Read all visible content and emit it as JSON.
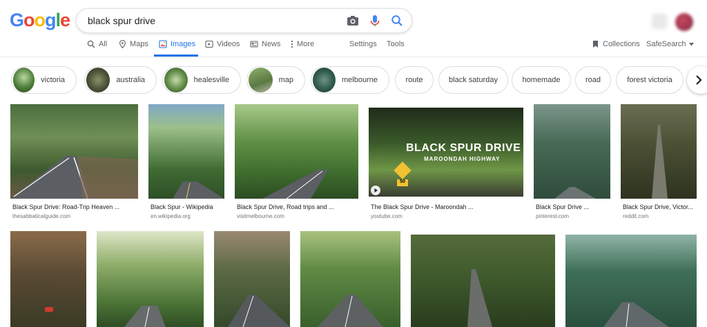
{
  "search": {
    "query": "black spur drive"
  },
  "tabs": [
    {
      "label": "All",
      "icon": "search-icon"
    },
    {
      "label": "Maps",
      "icon": "map-pin-icon"
    },
    {
      "label": "Images",
      "icon": "image-icon"
    },
    {
      "label": "Videos",
      "icon": "video-icon"
    },
    {
      "label": "News",
      "icon": "news-icon"
    },
    {
      "label": "More",
      "icon": "more-vert-icon"
    }
  ],
  "tools": {
    "settings": "Settings",
    "tools": "Tools",
    "collections": "Collections",
    "safesearch": "SafeSearch"
  },
  "chips": [
    "victoria",
    "australia",
    "healesville",
    "map",
    "melbourne",
    "route",
    "black saturday",
    "homemade",
    "road",
    "forest victoria"
  ],
  "results": [
    {
      "title": "Black Spur Drive: Road-Trip Heaven ...",
      "source": "thesabbaticalguide.com"
    },
    {
      "title": "Black Spur - Wikipedia",
      "source": "en.wikipedia.org"
    },
    {
      "title": "Black Spur Drive, Road trips and ...",
      "source": "visitmelbourne.com"
    },
    {
      "title": "The Black Spur Drive - Maroondah ...",
      "source": "youtube.com"
    },
    {
      "title": "Black Spur Drive ...",
      "source": "pinterest.com"
    },
    {
      "title": "Black Spur Drive, Victor...",
      "source": "reddit.com"
    }
  ],
  "video_overlay": {
    "title": "BLACK SPUR DRIVE",
    "subtitle": "MAROONDAH HIGHWAY",
    "sign": "50"
  },
  "colors": {
    "accent": "#1a73e8",
    "forest": "#2f5a2a",
    "road": "#5b5f63"
  }
}
